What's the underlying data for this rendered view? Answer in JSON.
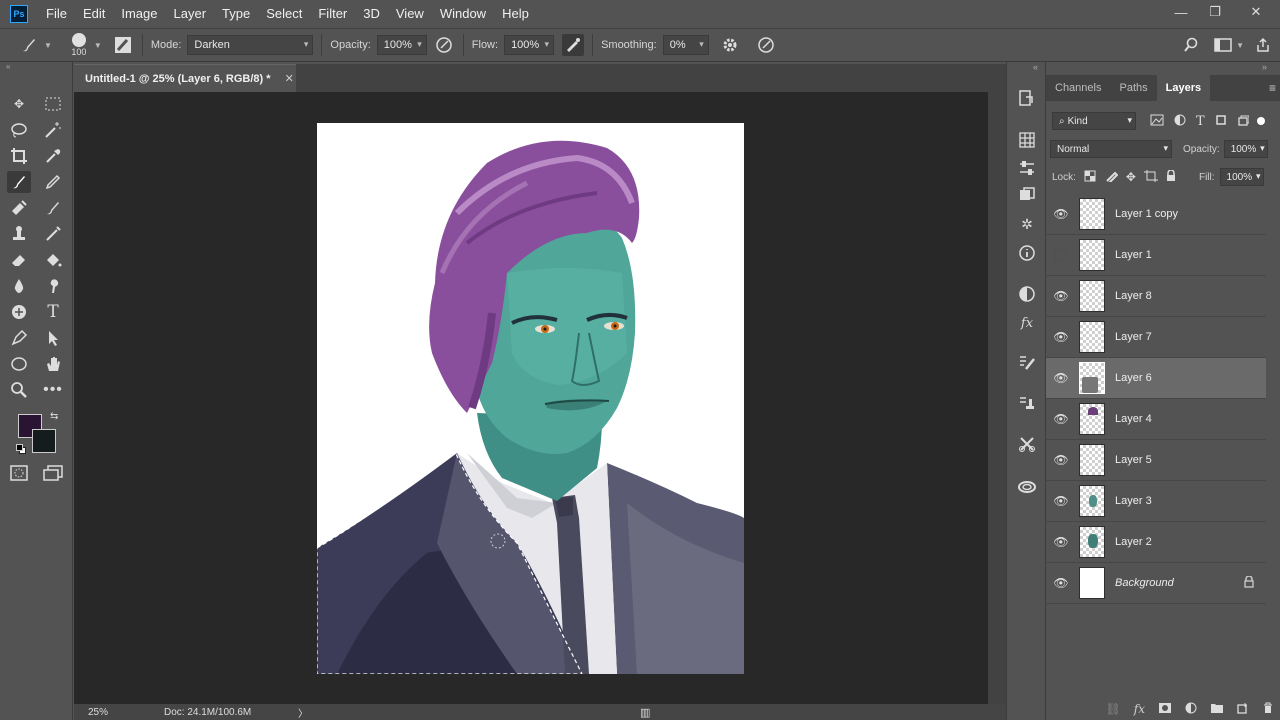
{
  "app": {
    "logo": "Ps"
  },
  "menu": [
    "File",
    "Edit",
    "Image",
    "Layer",
    "Type",
    "Select",
    "Filter",
    "3D",
    "View",
    "Window",
    "Help"
  ],
  "window_controls": {
    "minimize": "—",
    "restore": "❐",
    "close": "✕"
  },
  "options": {
    "brush_size": "100",
    "mode_label": "Mode:",
    "mode_value": "Darken",
    "opacity_label": "Opacity:",
    "opacity_value": "100%",
    "flow_label": "Flow:",
    "flow_value": "100%",
    "smoothing_label": "Smoothing:",
    "smoothing_value": "0%"
  },
  "document": {
    "tab_title": "Untitled-1 @ 25% (Layer 6, RGB/8) *",
    "tab_close": "✕"
  },
  "status": {
    "zoom": "25%",
    "doc_info": "Doc: 24.1M/100.6M",
    "arrow": "〉"
  },
  "colors": {
    "foreground": "#2a1433",
    "background": "#141c1e",
    "ui_bg": "#535353",
    "canvas_bg": "#282828"
  },
  "panel": {
    "tabs": [
      "Channels",
      "Paths",
      "Layers"
    ],
    "active_tab": "Layers",
    "filter_kind": "Kind",
    "blend_mode": "Normal",
    "opacity_label": "Opacity:",
    "opacity_value": "100%",
    "lock_label": "Lock:",
    "fill_label": "Fill:",
    "fill_value": "100%",
    "layers": [
      {
        "name": "Layer 1 copy",
        "visible": true,
        "selected": false,
        "italic": false
      },
      {
        "name": "Layer 1",
        "visible": false,
        "selected": false,
        "italic": false
      },
      {
        "name": "Layer 8",
        "visible": true,
        "selected": false,
        "italic": false
      },
      {
        "name": "Layer 7",
        "visible": true,
        "selected": false,
        "italic": false
      },
      {
        "name": "Layer 6",
        "visible": true,
        "selected": true,
        "italic": false
      },
      {
        "name": "Layer 4",
        "visible": true,
        "selected": false,
        "italic": false
      },
      {
        "name": "Layer 5",
        "visible": true,
        "selected": false,
        "italic": false
      },
      {
        "name": "Layer 3",
        "visible": true,
        "selected": false,
        "italic": false
      },
      {
        "name": "Layer 2",
        "visible": true,
        "selected": false,
        "italic": false
      },
      {
        "name": "Background",
        "visible": true,
        "selected": false,
        "italic": true,
        "locked": true
      }
    ]
  }
}
